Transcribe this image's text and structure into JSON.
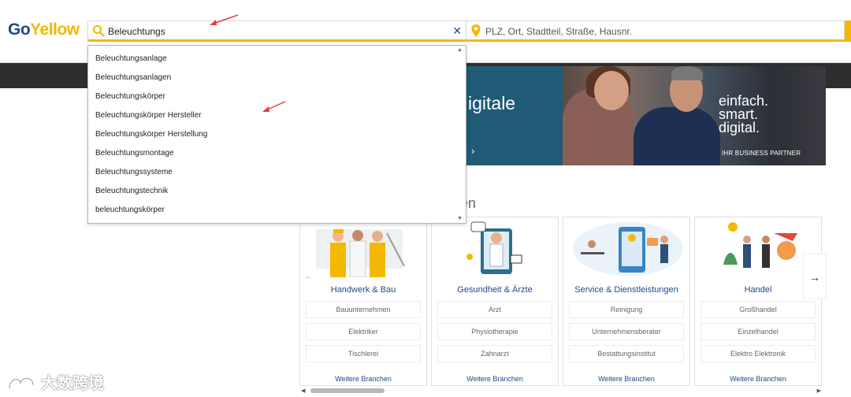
{
  "logo": {
    "part1": "Go",
    "part2": "Yellow"
  },
  "search": {
    "value": "Beleuchtungs",
    "clear_symbol": "✕",
    "location_placeholder": "PLZ, Ort, Stadtteil, Straße, Hausnr."
  },
  "autocomplete": {
    "items": [
      "Beleuchtungsanlage",
      "Beleuchtungsanlagen",
      "Beleuchtungskörper",
      "Beleuchtungskörper Hersteller",
      "Beleuchtungskörper Herstellung",
      "Beleuchtungsmontage",
      "Beleuchtungssysteme",
      "Beleuchtungstechnik",
      "beleuchtungskörper"
    ]
  },
  "banner": {
    "heading_fragment": "igitale",
    "chevron": "›",
    "slogan_line1": "einfach.",
    "slogan_line2": "smart.",
    "slogan_line3": "digital.",
    "partner": "IHR BUSINESS PARTNER"
  },
  "section": {
    "heading_fragment": "en"
  },
  "categories": [
    {
      "title": "Handwerk & Bau",
      "links": [
        "Bauunternehmen",
        "Elektriker",
        "Tischlerei"
      ],
      "more": "Weitere Branchen"
    },
    {
      "title": "Gesundheit & Ärzte",
      "links": [
        "Arzt",
        "Physiotherapie",
        "Zahnarzt"
      ],
      "more": "Weitere Branchen"
    },
    {
      "title": "Service & Dienstleistungen",
      "links": [
        "Reinigung",
        "Unternehmensberater",
        "Bestattungsinstitut"
      ],
      "more": "Weitere Branchen"
    },
    {
      "title": "Handel",
      "links": [
        "Großhandel",
        "Einzelhandel",
        "Elektro Elektronik"
      ],
      "more": "Weitere Branchen"
    }
  ],
  "carousel": {
    "next": "→",
    "prev": "←"
  },
  "watermark": {
    "text": "大数跨境"
  },
  "colors": {
    "brand_yellow": "#f5b800",
    "brand_blue": "#1e4a86",
    "annotation_red": "#e0403a"
  }
}
